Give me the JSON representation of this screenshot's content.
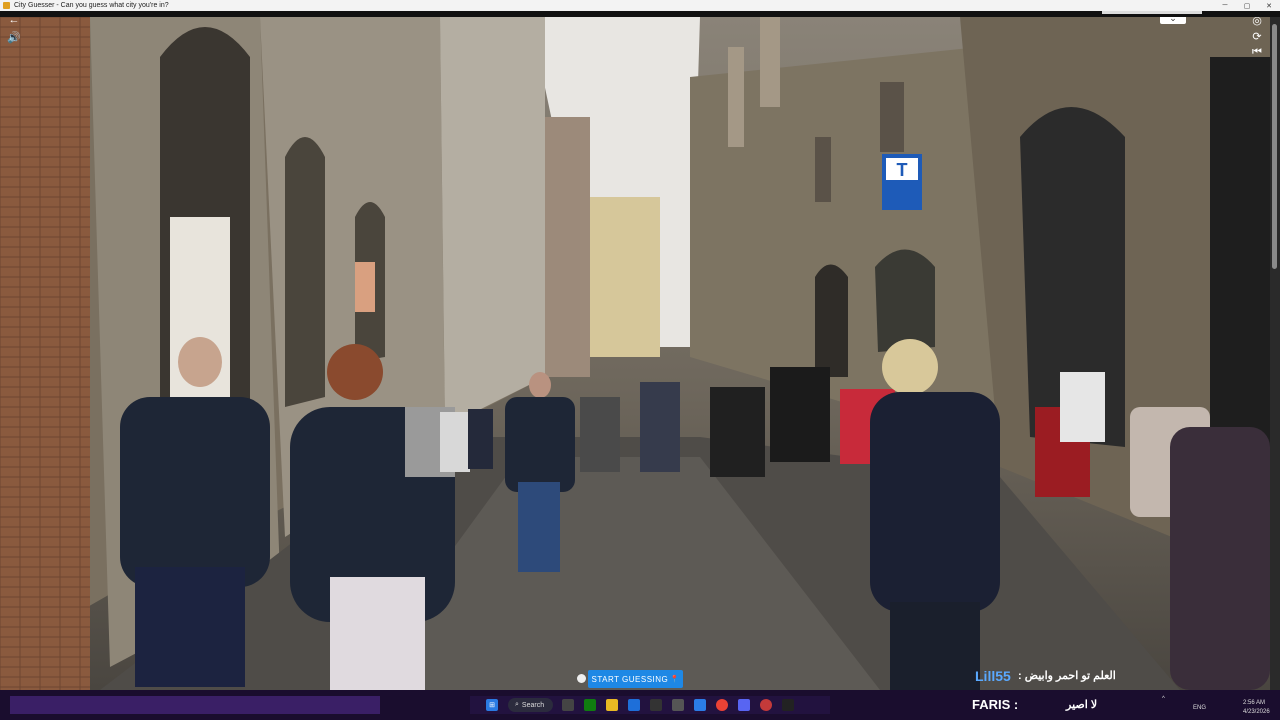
{
  "window": {
    "title": "City Guesser - Can you guess what city you're in?"
  },
  "controls": {
    "back": "←",
    "volume": "🔊",
    "collapse": "⌄",
    "target": "◎",
    "refresh": "⟳",
    "restart": "⏮"
  },
  "main": {
    "start_button": "START GUESSING",
    "pin_icon": "📍"
  },
  "overlay": {
    "arabic_text": "العلم تو احمر وابيض :",
    "username": "Lill55",
    "bottom_name": "FARIS :",
    "bottom_text": "لا اصير"
  },
  "taskbar": {
    "search_label": "Search",
    "lang": "ENG",
    "time": "2:56 AM",
    "date": "4/23/2026",
    "badge": "0"
  },
  "colors": {
    "accent": "#1e88e5",
    "username_color": "#5aa9ff",
    "taskbar": "#1a0d2e"
  }
}
